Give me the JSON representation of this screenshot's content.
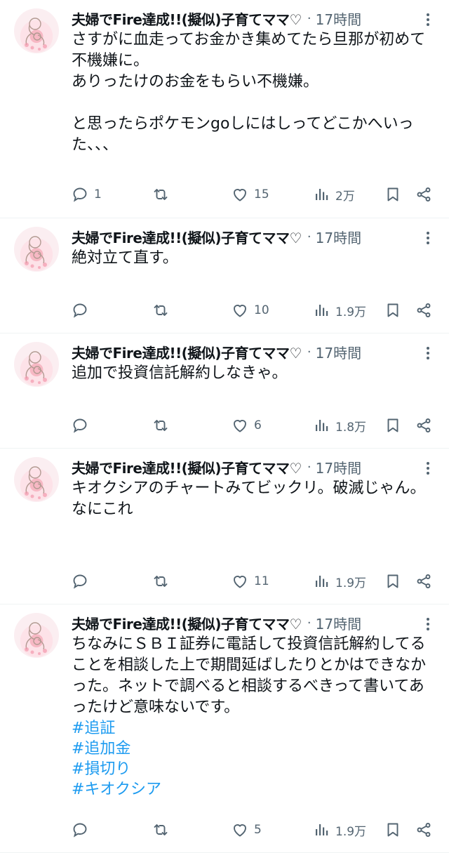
{
  "author": {
    "name": "夫婦でFire達成!!(擬似)子育てママ♡",
    "separator": "·",
    "time": "17時間"
  },
  "tweets": [
    {
      "text": "さすがに血走ってお金かき集めてたら旦那が初めて不機嫌に。\nありったけのお金をもらい不機嫌。\n\nと思ったらポケモンgoしにはしってどこかへいった、、、",
      "hashtags": [],
      "stats": {
        "replies": "1",
        "retweets": "",
        "likes": "15",
        "views": "2万"
      }
    },
    {
      "text": "絶対立て直す。",
      "hashtags": [],
      "stats": {
        "replies": "",
        "retweets": "",
        "likes": "10",
        "views": "1.9万"
      }
    },
    {
      "text": "追加で投資信託解約しなきゃ。",
      "hashtags": [],
      "stats": {
        "replies": "",
        "retweets": "",
        "likes": "6",
        "views": "1.8万"
      }
    },
    {
      "text": "キオクシアのチャートみてビックリ。破滅じゃん。\nなにこれ",
      "hashtags": [],
      "stats": {
        "replies": "",
        "retweets": "",
        "likes": "11",
        "views": "1.9万"
      }
    },
    {
      "text": "ちなみにＳＢＩ証券に電話して投資信託解約してることを相談した上で期間延ばしたりとかはできなかった。ネットで調べると相談するべきって書いてあったけど意味ないです。",
      "hashtags": [
        "#追証",
        "#追加金",
        "#損切り",
        "#キオクシア"
      ],
      "stats": {
        "replies": "",
        "retweets": "",
        "likes": "5",
        "views": "1.9万"
      }
    }
  ],
  "colors": {
    "text": "#0f1419",
    "secondary": "#536471",
    "link": "#1d9bf0",
    "divider": "#eff3f4"
  },
  "icons": {
    "reply": "reply-icon",
    "retweet": "retweet-icon",
    "like": "heart-icon",
    "views": "views-chart-icon",
    "bookmark": "bookmark-icon",
    "share": "share-icon",
    "more": "more-dots-icon"
  }
}
